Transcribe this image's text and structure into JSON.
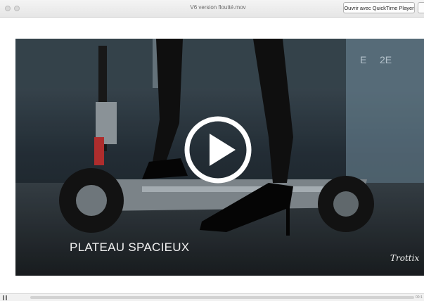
{
  "window": {
    "title": "V6 version floutté.mov",
    "open_button_label": "Ouvrir avec QuickTime Player"
  },
  "video": {
    "caption": "PLATEAU SPACIEUX",
    "brand": "Trottix",
    "play_icon": "play-icon"
  },
  "controls": {
    "time": "00:1"
  }
}
